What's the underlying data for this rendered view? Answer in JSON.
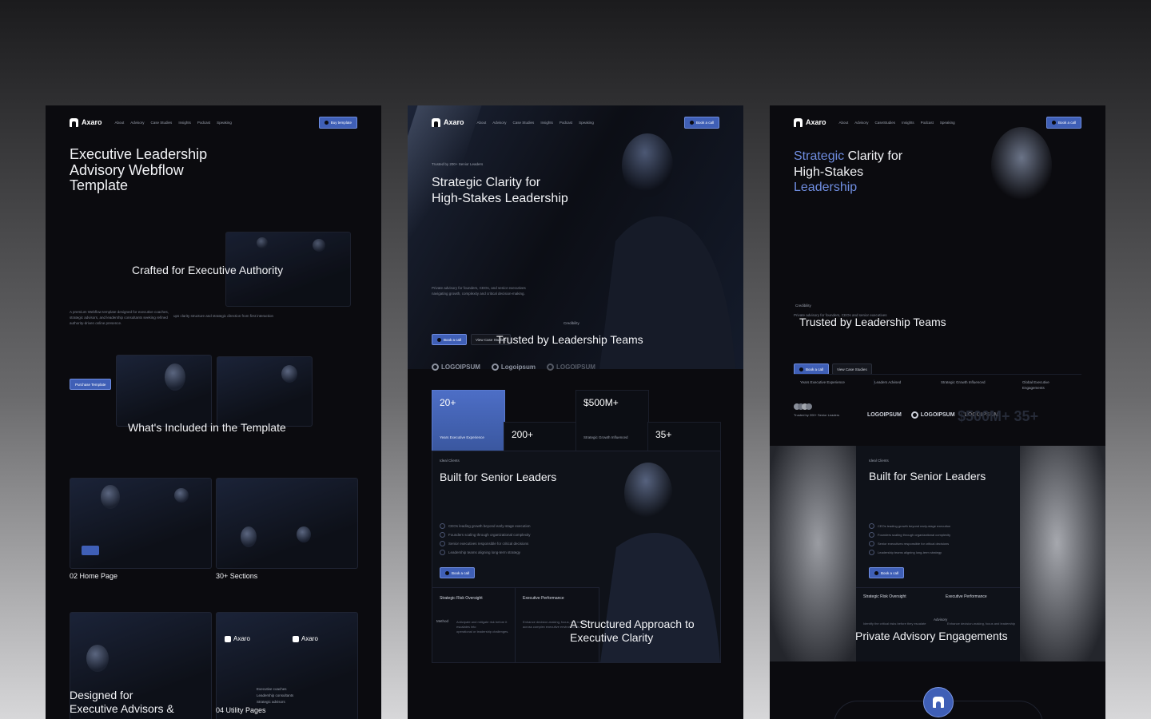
{
  "nav": {
    "brand": "Axaro",
    "links": [
      "About",
      "Advisory",
      "Case Studies",
      "Insights",
      "Podcast",
      "Speaking"
    ],
    "links_short": [
      "About",
      "Advisory",
      "CaseStudies",
      "Insights",
      "Podcast",
      "Speaking"
    ]
  },
  "panel1": {
    "buy_button": "Buy template",
    "title_line1": "Executive Leadership",
    "title_line2": "Advisory Webflow",
    "title_line3": "Template",
    "crafted_heading": "Crafted for Executive Authority",
    "desc_line1": "A premium Webflow template designed for executive coaches,",
    "desc_line2": "strategic advisors, and leadership consultants seeking refined",
    "desc_line3": "authority-driven online presence.",
    "desc_right": "ups clarity structure and strategic direction from first interaction",
    "purchase_button": "Purchase Template",
    "included_heading": "What's Included in the Template",
    "home_pages_label": "02 Home Page",
    "sections_label": "30+ Sections",
    "designed_line1": "Designed for",
    "designed_line2": "Executive Advisors &",
    "utility_label": "04 Utility Pages",
    "mini_brand": "Axaro",
    "mini_features": [
      "Executive coaches",
      "Leadership consultants",
      "Strategic advisors"
    ]
  },
  "panel2": {
    "book_call": "Book a call",
    "trusted_badge": "Trusted by 200+ Senior Leaders",
    "hero_line1": "Strategic Clarity for",
    "hero_line2": "High-Stakes Leadership",
    "hero_desc_line1": "Private advisory for founders, CEOs, and senior executives",
    "hero_desc_line2": "navigating growth, complexity and critical decision-making.",
    "credibility_badge": "Credibility",
    "view_cases": "View Case Studies",
    "trusted_heading": "Trusted by Leadership Teams",
    "logos": [
      "LOGOIPSUM",
      "Logoipsum",
      "LOGOIPSUM"
    ],
    "stats": [
      {
        "value": "20+",
        "label": "Years Executive Experience"
      },
      {
        "value": "200+",
        "label": "Leaders Advised"
      },
      {
        "value": "$500M+",
        "label": "Strategic Growth Influenced"
      },
      {
        "value": "35+",
        "label": "Global Executive Engagements"
      }
    ],
    "ideal_badge": "Ideal Clients",
    "built_heading": "Built for Senior Leaders",
    "checks": [
      "CEOs leading growth beyond early-stage execution",
      "Founders scaling through organizational complexity",
      "Senior executives responsible for critical decisions",
      "Leadership teams aligning long-term strategy"
    ],
    "risk_label": "Strategic Risk Oversight",
    "perf_label": "Executive Performance",
    "method_badge": "Method",
    "method_desc_line1": "Anticipate and mitigate risk before it escalates into",
    "method_desc_line2": "operational or leadership challenges.",
    "perf_desc_line1": "Enhance decision-making, focus, and leadership",
    "perf_desc_line2": "across complex executive environments.",
    "approach_line1": "A Structured Approach to",
    "approach_line2": "Executive Clarity"
  },
  "panel3": {
    "book_call": "Book a call",
    "hero_accent1": "Strategic",
    "hero_rest1": " Clarity for",
    "hero_line2": "High-Stakes",
    "hero_line3": "Leadership",
    "credibility_badge": "Credibility",
    "trusted_heading": "Trusted by Leadership Teams",
    "overlap_desc": "Private advisory for founders, CEOs and senior executives",
    "view_cases": "View Case Studies",
    "stat_labels": [
      "Years Executive Experience",
      "Leaders Advised",
      "Strategic Growth Influenced",
      "Global Executive Engagements"
    ],
    "trusted_small": "Trusted by 200+ Senior Leaders",
    "logos": [
      "LOGOIPSUM",
      "LOGOIPSUM",
      "LOGOIPSUM"
    ],
    "big_numbers": "$500M+ 35+",
    "ideal_badge": "Ideal Clients",
    "built_heading": "Built for Senior Leaders",
    "checks": [
      "CEOs leading growth beyond early-stage execution",
      "Founders scaling through organizational complexity",
      "Senior executives responsible for critical decisions",
      "Leadership teams aligning long-term strategy"
    ],
    "risk_label": "Strategic Risk Oversight",
    "perf_label": "Executive Performance",
    "advisory_badge": "Advisory",
    "risk_desc": "Identify the critical risks before they escalate",
    "perf_desc": "Enhance decision-making, focus and leadership",
    "private_heading": "Private Advisory Engagements"
  },
  "colors": {
    "accent": "#3f5fb6",
    "accent_text": "#6f8de0",
    "panel_bg": "#0b0b0f"
  },
  "icons": [
    "home-logo-icon",
    "check-circle-icon",
    "dot-icon"
  ]
}
